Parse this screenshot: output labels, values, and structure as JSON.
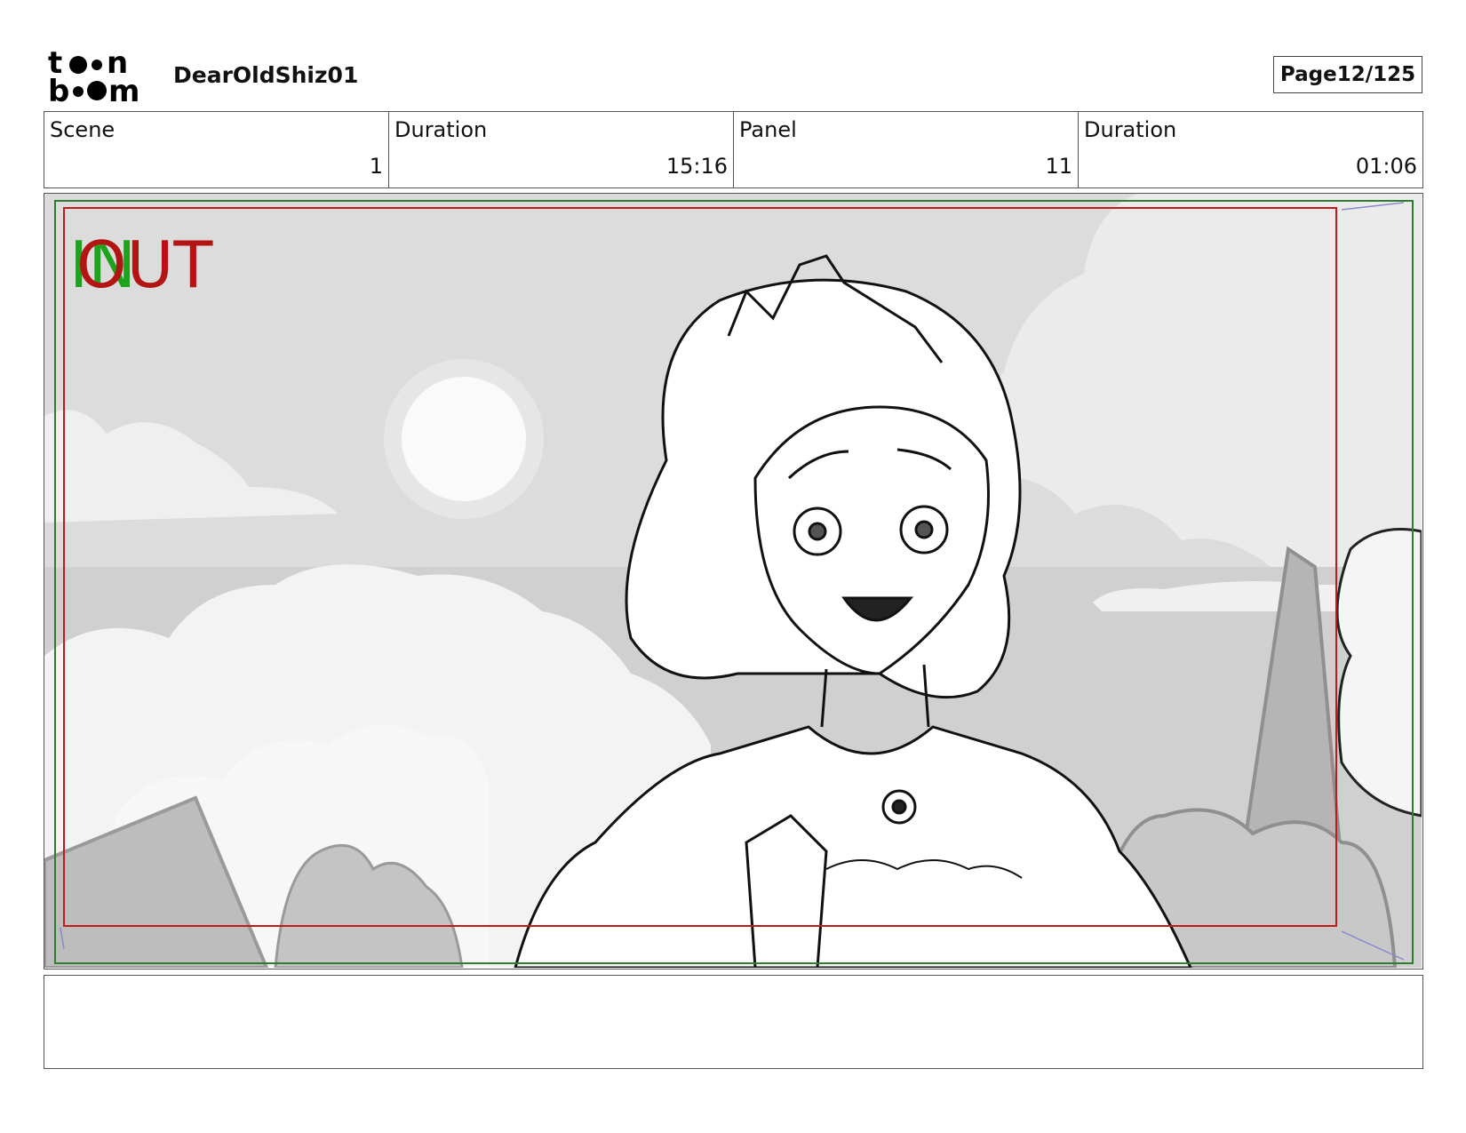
{
  "header": {
    "logo_top": "t•o•n",
    "logo_bottom": "b•o•m",
    "project": "DearOldShiz01",
    "page_label": "Page",
    "page_number": "12/125"
  },
  "info": {
    "scene_label": "Scene",
    "scene_value": "1",
    "scene_duration_label": "Duration",
    "scene_duration_value": "15:16",
    "panel_label": "Panel",
    "panel_value": "11",
    "panel_duration_label": "Duration",
    "panel_duration_value": "01:06"
  },
  "panel": {
    "in_marker": "IN",
    "out_marker": "OUT",
    "in_color": "#1fa31f",
    "out_color": "#b31414",
    "frame_green": "#2f7d2f",
    "frame_red": "#c21a1a"
  },
  "notes": {
    "text": ""
  }
}
